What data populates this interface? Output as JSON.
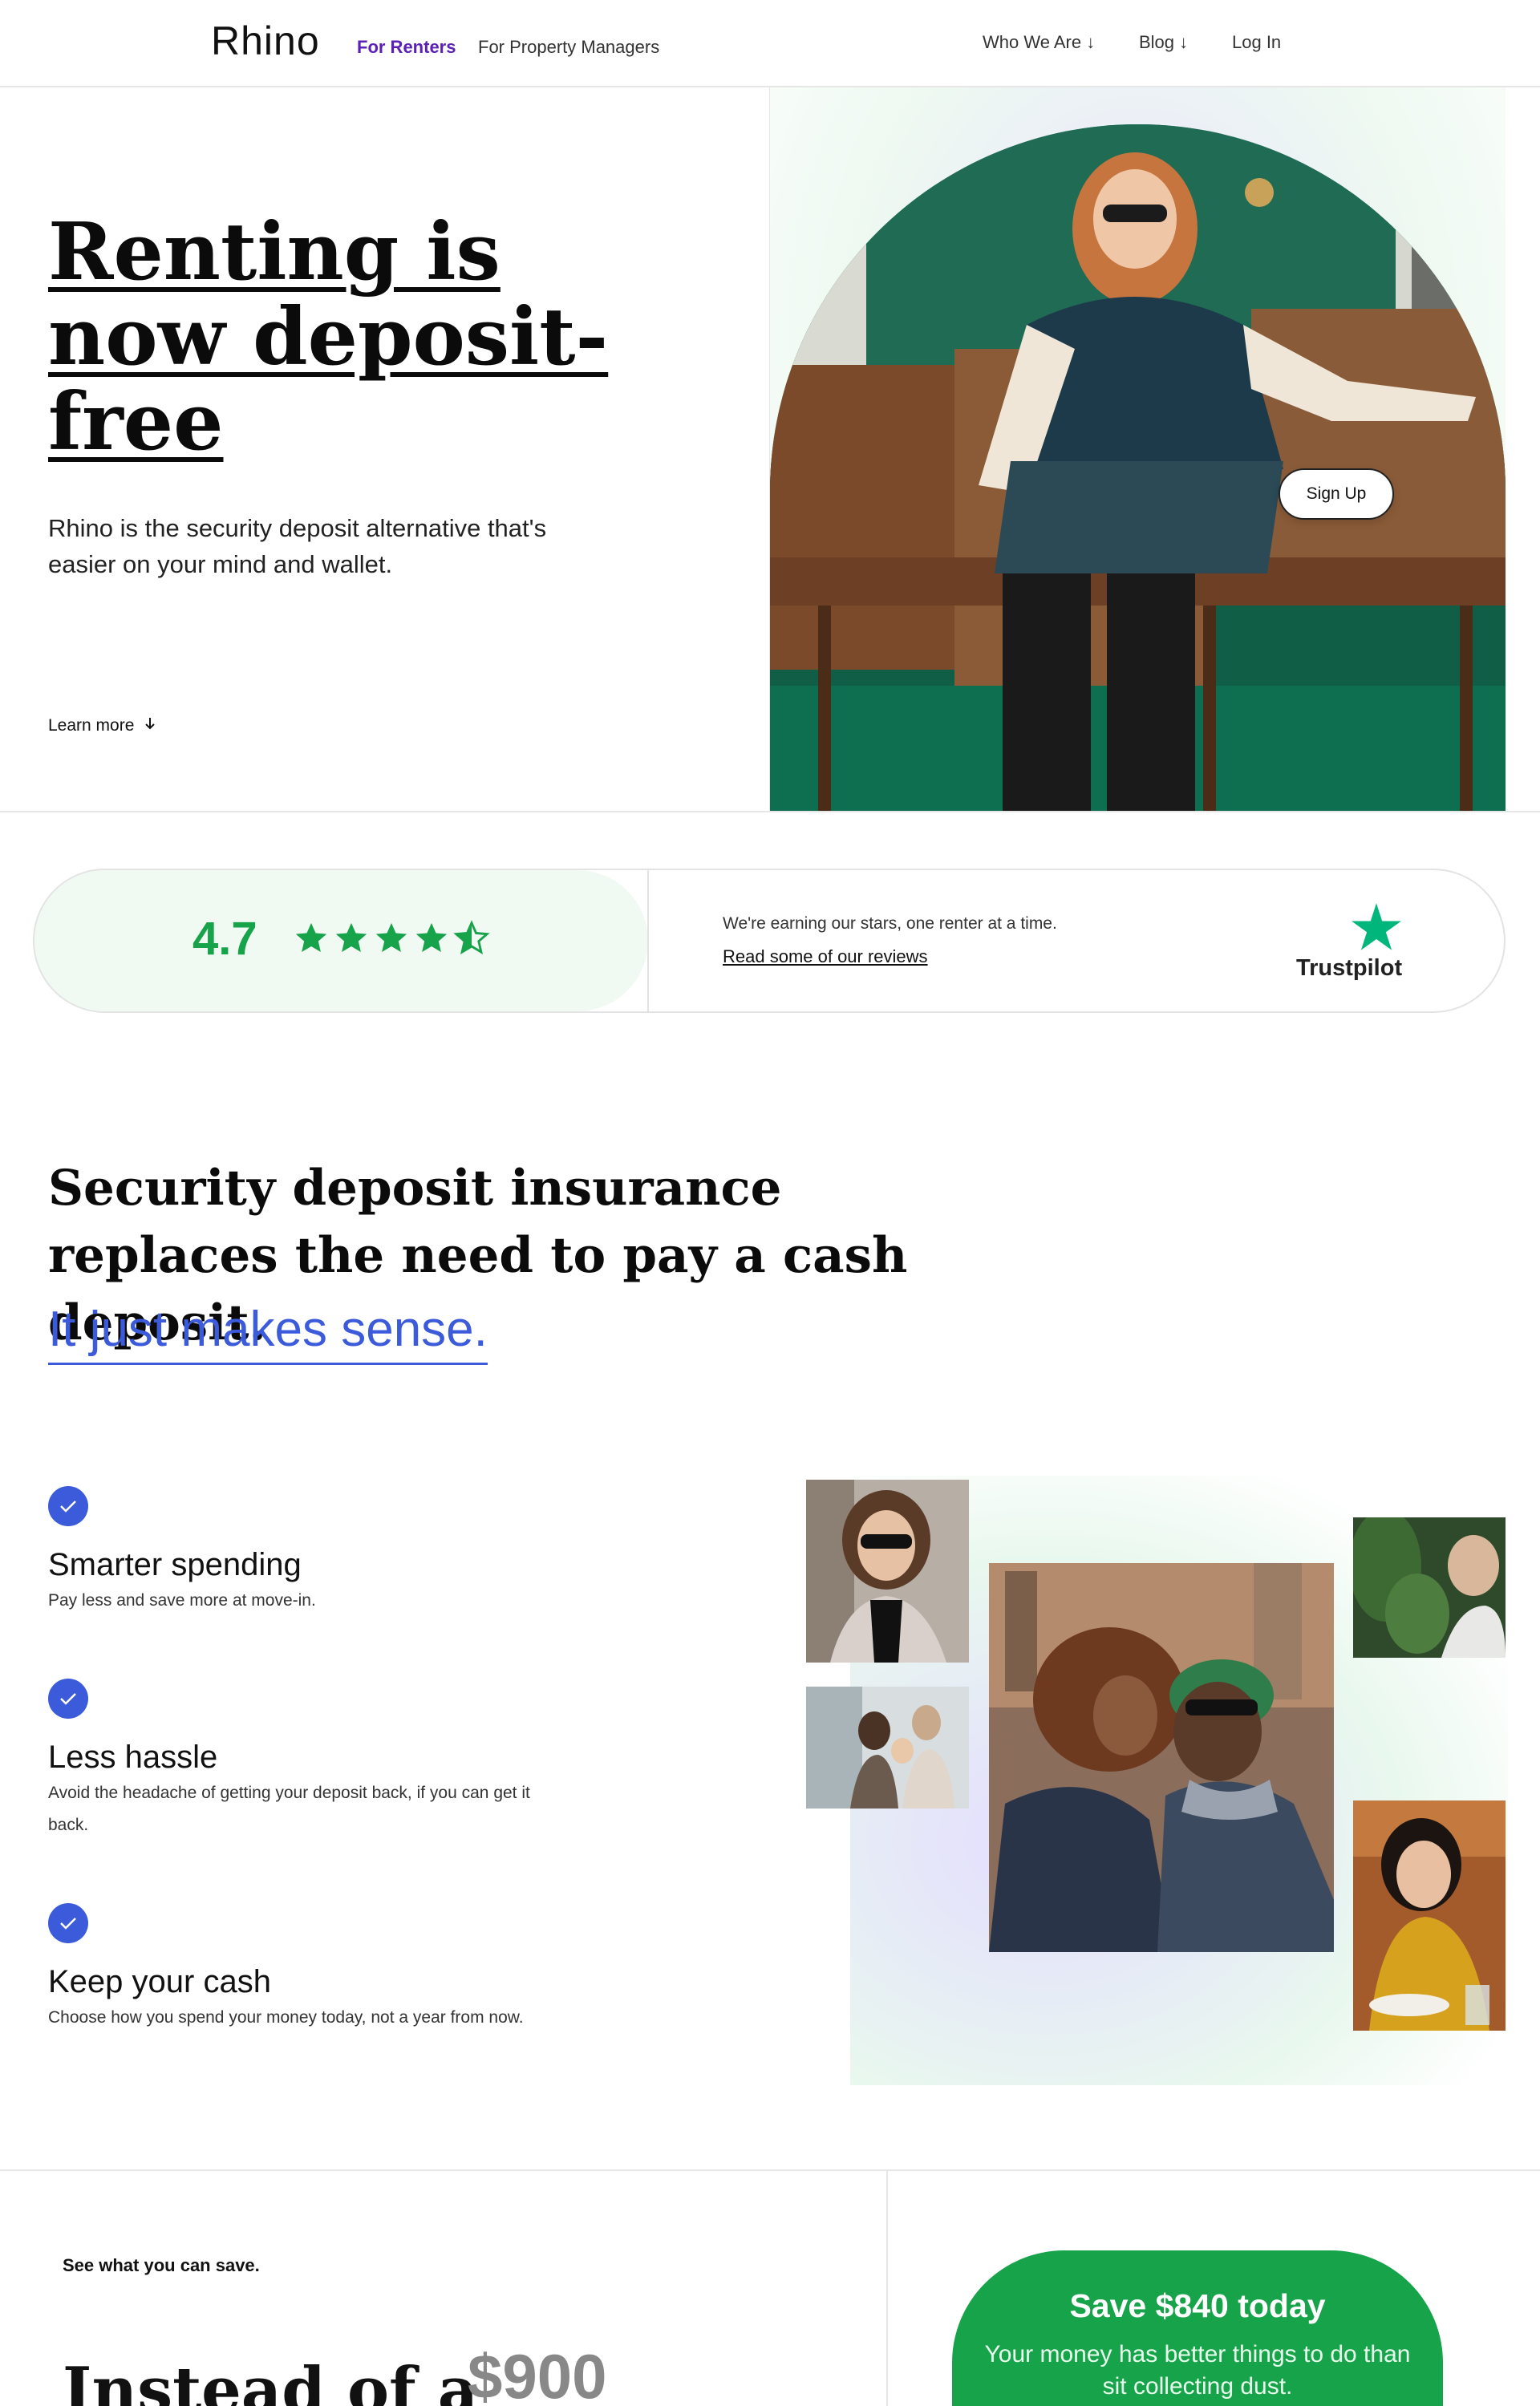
{
  "nav": {
    "logo": "Rhino",
    "links": [
      {
        "label": "For Renters"
      },
      {
        "label": "For Property Managers"
      }
    ],
    "right_links": [
      {
        "label": "Who We Are ↓"
      },
      {
        "label": "Blog ↓"
      },
      {
        "label": "Log In"
      }
    ]
  },
  "hero": {
    "title": "Renting is now deposit-free",
    "subtitle": "Rhino is the security deposit alternative that's easier on your mind and wallet.",
    "learn_more": "Learn more",
    "signup": "Sign Up"
  },
  "rating": {
    "score": "4.7",
    "stars": 4.7,
    "text": "We're earning our stars, one renter at a time.",
    "link": "Read some of our reviews",
    "provider": "Trustpilot"
  },
  "section": {
    "title": "Security deposit insurance replaces the need to pay a cash deposit.",
    "accent": "It just makes sense.",
    "features": [
      {
        "title": "Smarter spending",
        "desc": "Pay less and save more at move-in."
      },
      {
        "title": "Less hassle",
        "desc": "Avoid the headache of getting your deposit back, if you can get it back."
      },
      {
        "title": "Keep your cash",
        "desc": "Choose how you spend your money today, not a year from now."
      }
    ]
  },
  "savings": {
    "label": "See what you can save.",
    "instead": "Instead of a",
    "price": "$900",
    "card_title": "Save $840 today",
    "card_sub": "Your money has better things to do than sit collecting dust."
  },
  "colors": {
    "accent_purple": "#5b21b6",
    "accent_blue": "#3b5bdb",
    "accent_green": "#16a34a",
    "trustpilot_green": "#00b67a"
  }
}
